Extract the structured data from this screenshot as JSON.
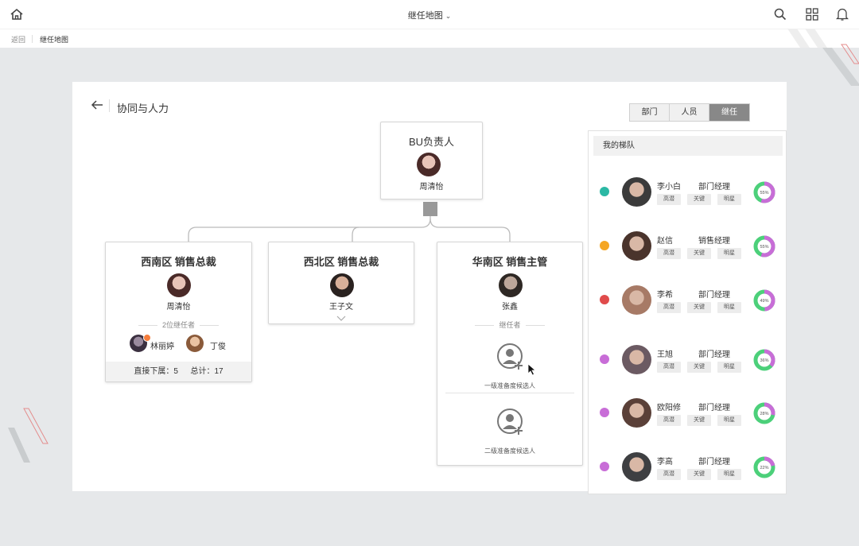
{
  "header": {
    "title": "继任地图",
    "icons": {
      "home": "home-icon",
      "dropdown": "chevron-down-icon",
      "search": "search-icon",
      "apps": "grid-icon",
      "notifications": "bell-icon"
    }
  },
  "breadcrumb": {
    "back": "返回",
    "current": "继任地图"
  },
  "panel": {
    "title": "协同与人力"
  },
  "tabs": [
    {
      "label": "部门",
      "active": false
    },
    {
      "label": "人员",
      "active": false
    },
    {
      "label": "继任",
      "active": true
    }
  ],
  "org": {
    "root": {
      "title": "BU负责人",
      "name": "周清怡"
    },
    "children": [
      {
        "title": "西南区  销售总裁",
        "name": "周清怡",
        "successor_label": "2位继任者",
        "successors": [
          {
            "name": "林丽婷"
          },
          {
            "name": "丁俊"
          }
        ],
        "footer": {
          "direct": "直接下属：5",
          "total": "总计：17"
        }
      },
      {
        "title": "西北区  销售总裁",
        "name": "王子文"
      },
      {
        "title": "华南区  销售主管",
        "name": "张鑫",
        "successor_label": "继任者",
        "slots": [
          {
            "label": "一级准备度候选人"
          },
          {
            "label": "二级准备度候选人"
          }
        ]
      }
    ]
  },
  "sidebar": {
    "title": "我的梯队",
    "members": [
      {
        "name": "李小白",
        "role": "部门经理",
        "tags": [
          "高潜",
          "关键",
          "明星"
        ],
        "percent": 55,
        "status_color": "#2bb8a4",
        "avatar_color": "#3b3b3b",
        "label": "55%"
      },
      {
        "name": "赵信",
        "role": "销售经理",
        "tags": [
          "高潜",
          "关键",
          "明星"
        ],
        "percent": 55,
        "status_color": "#f5a623",
        "avatar_color": "#4a342c",
        "label": "55%"
      },
      {
        "name": "李希",
        "role": "部门经理",
        "tags": [
          "高潜",
          "关键",
          "明星"
        ],
        "percent": 49,
        "status_color": "#e04b4b",
        "avatar_color": "#a77a66",
        "label": "49%"
      },
      {
        "name": "王旭",
        "role": "部门经理",
        "tags": [
          "高潜",
          "关键",
          "明星"
        ],
        "percent": 36,
        "status_color": "#c86dd7",
        "avatar_color": "#6b5a62",
        "label": "36%"
      },
      {
        "name": "欧阳修",
        "role": "部门经理",
        "tags": [
          "高潜",
          "关键",
          "明星"
        ],
        "percent": 28,
        "status_color": "#c86dd7",
        "avatar_color": "#5a4038",
        "label": "28%"
      },
      {
        "name": "李高",
        "role": "部门经理",
        "tags": [
          "高潜",
          "关键",
          "明星"
        ],
        "percent": 22,
        "status_color": "#c86dd7",
        "avatar_color": "#3e3f42",
        "label": "22%"
      }
    ]
  },
  "colors": {
    "donut_progress": "#c86dd7",
    "donut_remaining": "#4cd07a",
    "tab_active": "#888888"
  }
}
